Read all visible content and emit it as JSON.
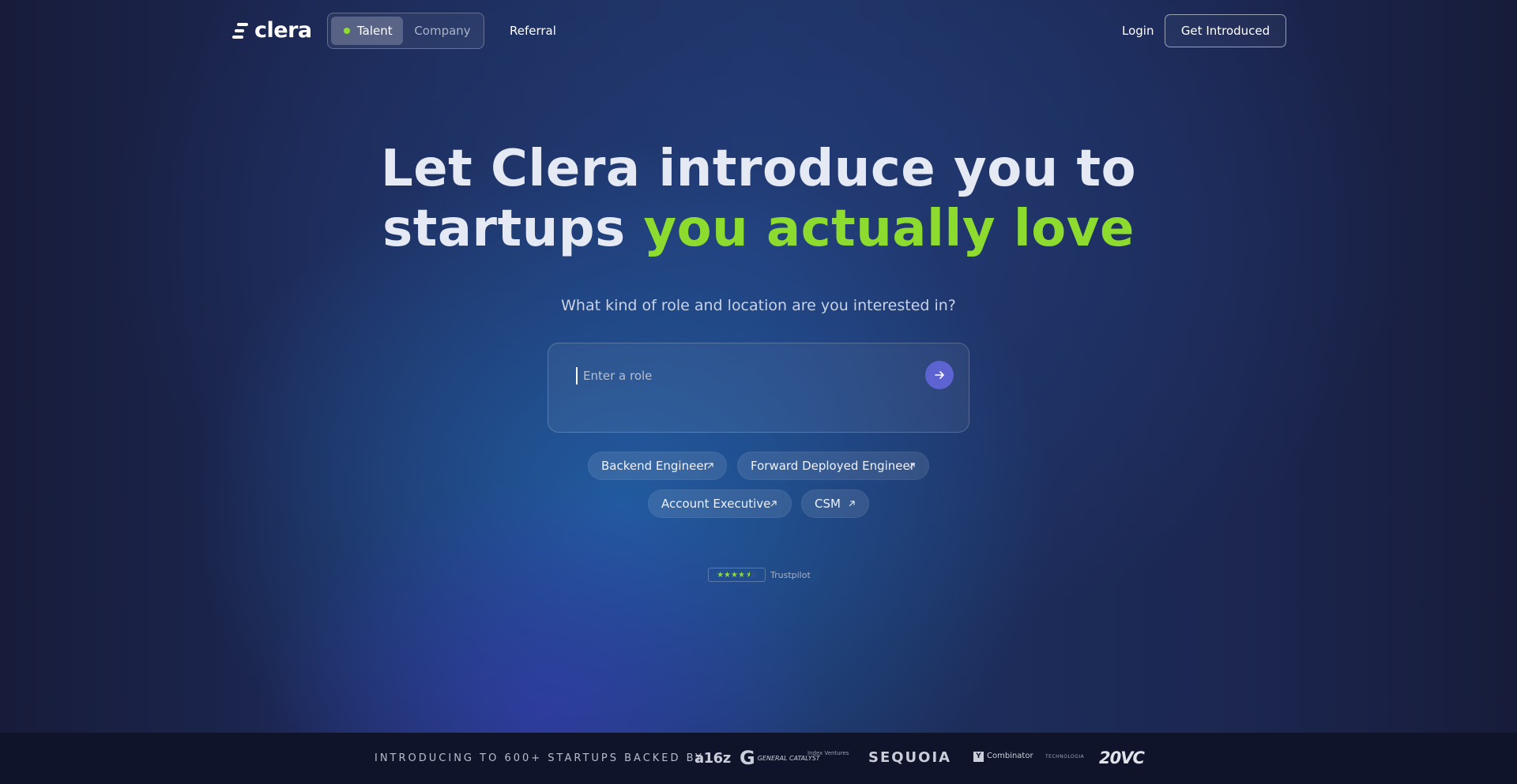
{
  "nav": {
    "logo_text": "clera",
    "toggle": {
      "talent_label": "Talent",
      "company_label": "Company",
      "selected": "Talent"
    },
    "referral_label": "Referral",
    "login_label": "Login",
    "cta_label": "Get Introduced"
  },
  "hero": {
    "headline_line1": "Let Clera introduce you to",
    "headline_line2_plain": "startups",
    "headline_line2_accent": "you actually love",
    "subheading": "What kind of role and location are you interested in?",
    "search": {
      "placeholder": "Enter a role",
      "value": ""
    },
    "suggestions": [
      "Backend Engineer",
      "Forward Deployed Engineer",
      "Account Executive",
      "CSM"
    ],
    "rating": {
      "stars": 4.5,
      "label": "Trustpilot"
    }
  },
  "backers": {
    "label": "INTRODUCING TO 600+ STARTUPS BACKED BY",
    "logos": [
      "a16z",
      "GENERAL CATALYST",
      "Index Ventures",
      "SEQUOIA",
      "Combinator",
      "TECHNOLOGIA",
      "20VC"
    ]
  },
  "colors": {
    "accent": "#8edb30",
    "submit_button": "#5d63d0",
    "strip_bg": "#10142b"
  }
}
